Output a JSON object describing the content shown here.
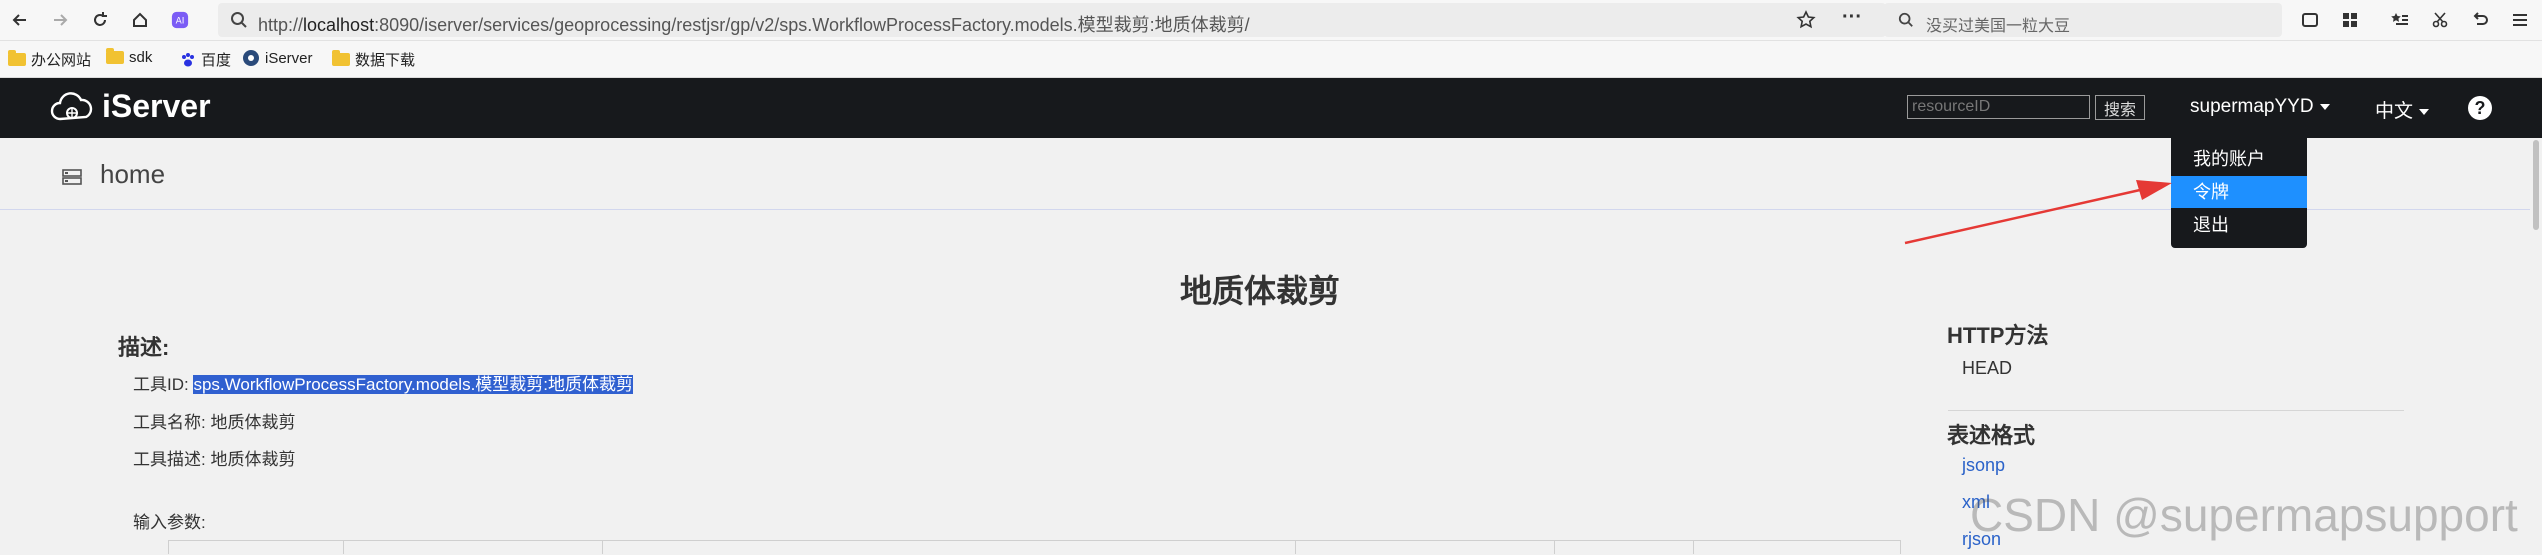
{
  "browser": {
    "url_prefix": "http://",
    "url_host": "localhost",
    "url_rest": ":8090/iserver/services/geoprocessing/restjsr/gp/v2/sps.WorkflowProcessFactory.models.模型裁剪:地质体裁剪/",
    "search_placeholder": "没买过美国一粒大豆",
    "more_label": "···"
  },
  "bookmarks": [
    {
      "label": "办公网站",
      "icon": "folder-icon"
    },
    {
      "label": "sdk",
      "icon": "folder-icon"
    },
    {
      "label": "百度",
      "icon": "baidu-paw-icon"
    },
    {
      "label": "iServer",
      "icon": "iserver-icon"
    },
    {
      "label": "数据下载",
      "icon": "folder-icon"
    }
  ],
  "app_nav": {
    "logo": "iServer",
    "resource_placeholder": "resourceID",
    "search_button": "搜索",
    "user": "supermapYYD",
    "language": "中文",
    "help": "?"
  },
  "user_dropdown": {
    "items": [
      "我的账户",
      "令牌",
      "退出"
    ],
    "active_index": 1
  },
  "breadcrumb": {
    "home": "home"
  },
  "main": {
    "title": "地质体裁剪",
    "description_heading": "描述:",
    "tool_id_label": "工具ID:",
    "tool_id_value": "sps.WorkflowProcessFactory.models.模型裁剪:地质体裁剪",
    "tool_name_label": "工具名称:",
    "tool_name_value": "地质体裁剪",
    "tool_desc_label": "工具描述:",
    "tool_desc_value": "地质体裁剪",
    "input_params_label": "输入参数:"
  },
  "right_panel": {
    "http_heading": "HTTP方法",
    "http_method": "HEAD",
    "format_heading": "表述格式",
    "formats": [
      "jsonp",
      "xml",
      "rjson"
    ]
  },
  "watermark": "CSDN @supermapsupport",
  "colors": {
    "nav_bg": "#17191c",
    "dropdown_active": "#1e90ff",
    "selection": "#3060d0",
    "link": "#2a62c9",
    "arrow": "#e53935"
  }
}
